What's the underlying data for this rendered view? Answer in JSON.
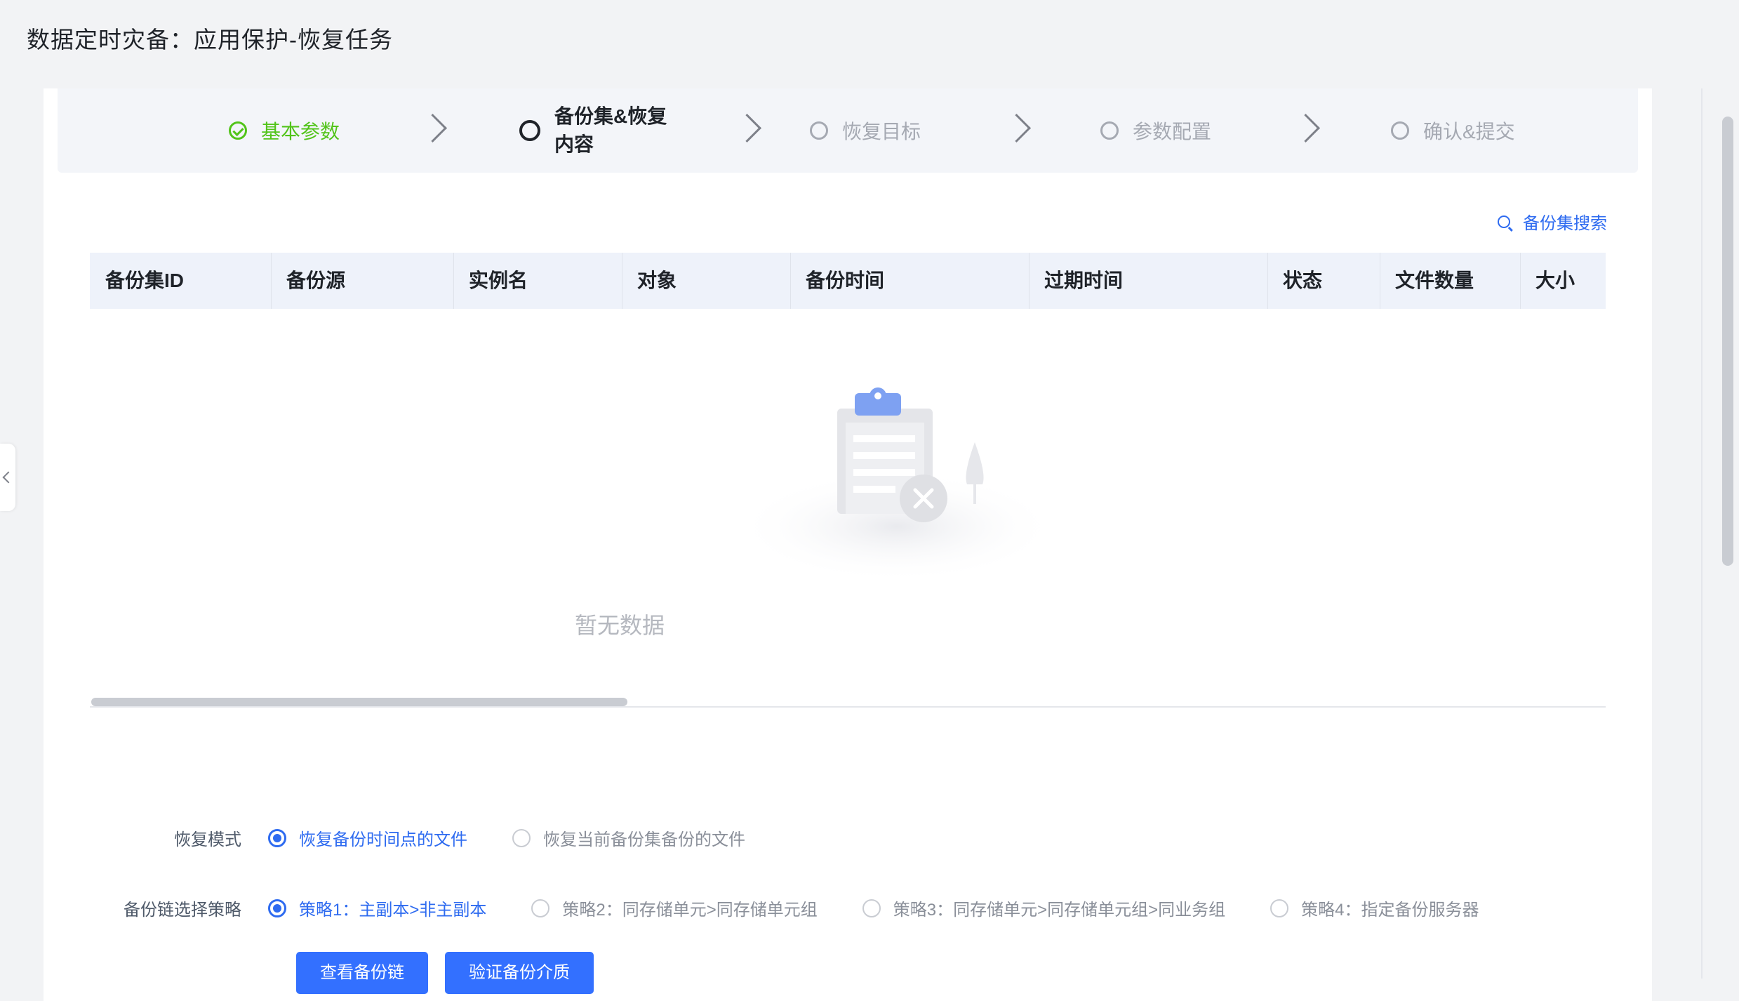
{
  "page": {
    "title": "数据定时灾备：应用保护-恢复任务"
  },
  "steps": [
    {
      "label": "基本参数",
      "state": "done"
    },
    {
      "label_line1": "备份集&恢复",
      "label_line2": "内容",
      "state": "active"
    },
    {
      "label": "恢复目标",
      "state": "pending"
    },
    {
      "label": "参数配置",
      "state": "pending"
    },
    {
      "label": "确认&提交",
      "state": "pending"
    }
  ],
  "search": {
    "label": "备份集搜索",
    "icon": "search-icon"
  },
  "table": {
    "columns": [
      "备份集ID",
      "备份源",
      "实例名",
      "对象",
      "备份时间",
      "过期时间",
      "状态",
      "文件数量",
      "大小"
    ],
    "rows": [],
    "empty_text": "暂无数据"
  },
  "form": {
    "restore_mode": {
      "label": "恢复模式",
      "options": [
        "恢复备份时间点的文件",
        "恢复当前备份集备份的文件"
      ],
      "selected": 0
    },
    "chain_strategy": {
      "label": "备份链选择策略",
      "options": [
        "策略1：主副本>非主副本",
        "策略2：同存储单元>同存储单元组",
        "策略3：同存储单元>同存储单元组>同业务组",
        "策略4：指定备份服务器"
      ],
      "selected": 0
    }
  },
  "buttons": {
    "view_chain": "查看备份链",
    "verify_media": "验证备份介质"
  },
  "colors": {
    "primary": "#3370ff",
    "link": "#2e6bf0",
    "success": "#52c41a",
    "header_bg": "#eef2fa"
  }
}
